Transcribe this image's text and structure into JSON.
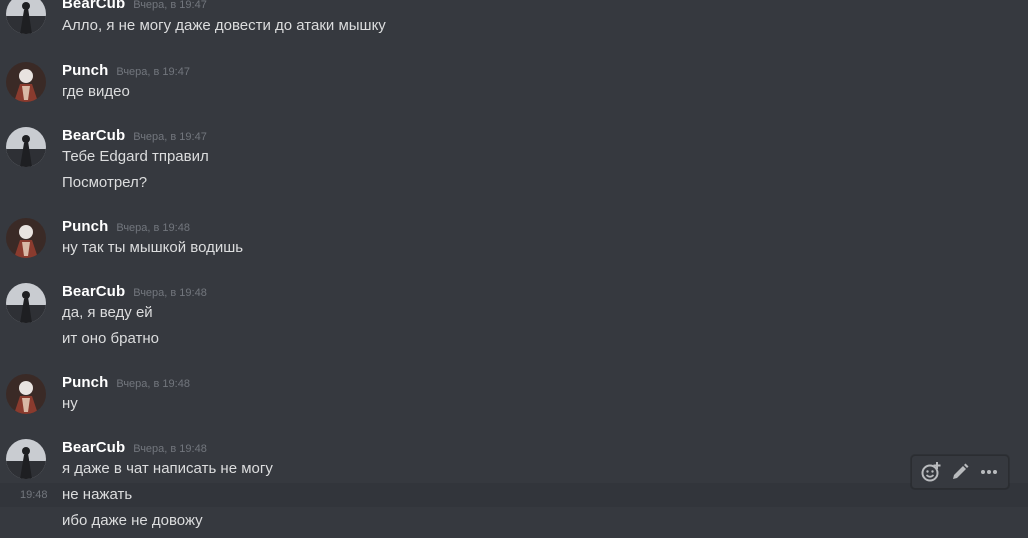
{
  "messages": [
    {
      "author": "BearCub",
      "time": "Вчера, в 19:47",
      "lines": [
        "Алло, я не могу даже довести до атаки мышку"
      ]
    },
    {
      "author": "Punch",
      "time": "Вчера, в 19:47",
      "lines": [
        "где видео"
      ]
    },
    {
      "author": "BearCub",
      "time": "Вчера, в 19:47",
      "lines": [
        "Тебе Edgard тправил",
        "Посмотрел?"
      ]
    },
    {
      "author": "Punch",
      "time": "Вчера, в 19:48",
      "lines": [
        "ну так ты мышкой водишь"
      ]
    },
    {
      "author": "BearCub",
      "time": "Вчера, в 19:48",
      "lines": [
        "да, я веду ей",
        "ит оно братно"
      ]
    },
    {
      "author": "Punch",
      "time": "Вчера, в 19:48",
      "lines": [
        "ну"
      ]
    },
    {
      "author": "BearCub",
      "time": "Вчера, в 19:48",
      "lines": [
        "я даже в чат написать не могу",
        "не нажать",
        "ибо даже не довожу"
      ]
    }
  ],
  "hovered_line_time": "19:48",
  "toolbar": {
    "icons": [
      "add-reaction-icon",
      "edit-icon",
      "more-options-icon"
    ]
  },
  "colors": {
    "background": "#36393f",
    "username": "#ffffff",
    "text": "#dcddde",
    "timestamp": "#72767d",
    "hover": "#32353b",
    "icon": "#b9bbbe"
  }
}
